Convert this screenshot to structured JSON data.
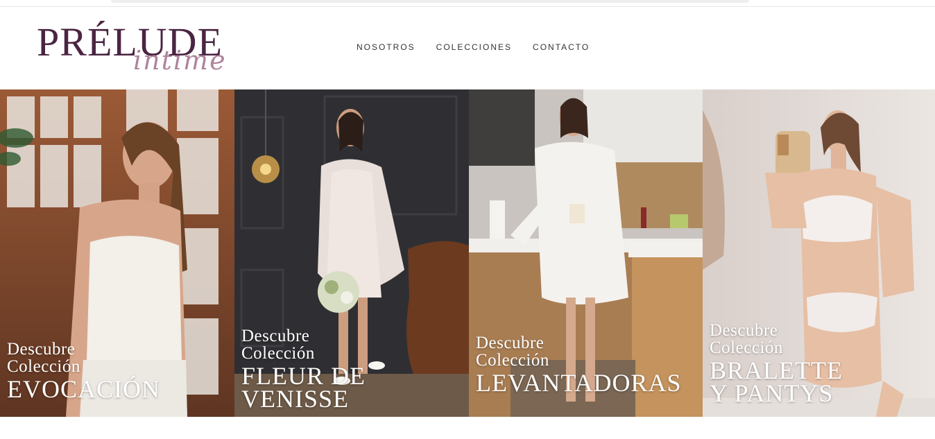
{
  "brand": {
    "name": "PRÉLUDE",
    "tagline": "intime"
  },
  "nav": {
    "items": [
      "NOSOTROS",
      "COLECCIONES",
      "CONTACTO"
    ]
  },
  "collections": [
    {
      "line1": "Descubre",
      "line2": "Colección",
      "title1": "EVOCACIÓN",
      "title2": ""
    },
    {
      "line1": "Descubre",
      "line2": "Colección",
      "title1": "FLEUR DE",
      "title2": "VENISSE"
    },
    {
      "line1": "Descubre",
      "line2": "Colección",
      "title1": "LEVANTADORAS",
      "title2": ""
    },
    {
      "line1": "Descubre",
      "line2": "Colección",
      "title1": "BRALETTE",
      "title2": "Y PANTYS"
    }
  ],
  "colors": {
    "brand": "#4a2542",
    "accent": "#b0849c",
    "caption": "#ffffff"
  }
}
